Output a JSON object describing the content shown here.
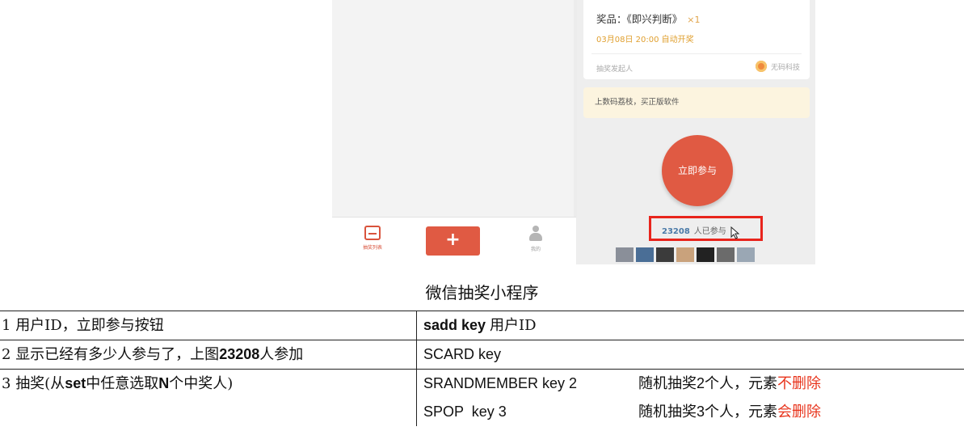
{
  "phone": {
    "bottom_nav": {
      "tab_list_label": "抽奖列表",
      "add_label": "+",
      "tab_me_label": "我的"
    },
    "card": {
      "prize_text": "奖品：《即兴判断》",
      "prize_qty": "×1",
      "draw_time": "03月08日 20:00 自动开奖",
      "initiator_label": "抽奖发起人",
      "sponsor_name": "无码科技"
    },
    "notice": "上数码荔枝，买正版软件",
    "join_button": "立即参与",
    "participant_count": "23208",
    "participant_suffix": "人已参与",
    "avatar_colors": [
      "#8a8f99",
      "#4a6e96",
      "#3b3b3b",
      "#c9a27c",
      "#222222",
      "#6b6b6b",
      "#9aa7b4"
    ]
  },
  "caption": "微信抽奖小程序",
  "table": {
    "row1": {
      "num": "1",
      "desc": "用户ID，立即参与按钮",
      "cmd_prefix": "sadd key ",
      "cmd_suffix": "用户ID"
    },
    "row2": {
      "num": "2",
      "desc_a": "显示已经有多少人参与了，上图",
      "desc_num": "23208",
      "desc_b": "人参加",
      "cmd": "SCARD key"
    },
    "row3": {
      "num": "3",
      "desc_a": "抽奖(从",
      "desc_set": "set",
      "desc_b": "中任意选取",
      "desc_n": "N",
      "desc_c": "个中奖人)",
      "line1_cmd": "SRANDMEMBER key 2",
      "line1_desc_a": "随机抽奖",
      "line1_num": "2",
      "line1_desc_b": "个人，元素",
      "line1_red": "不删除",
      "line2_cmd": "SPOP  key 3",
      "line2_desc_a": "随机抽奖",
      "line2_num": "3",
      "line2_desc_b": "个人，元素",
      "line2_red": "会删除"
    }
  },
  "colors": {
    "accent": "#e05a43",
    "highlight_box": "#e8241c",
    "warning_text": "#e8341c"
  }
}
